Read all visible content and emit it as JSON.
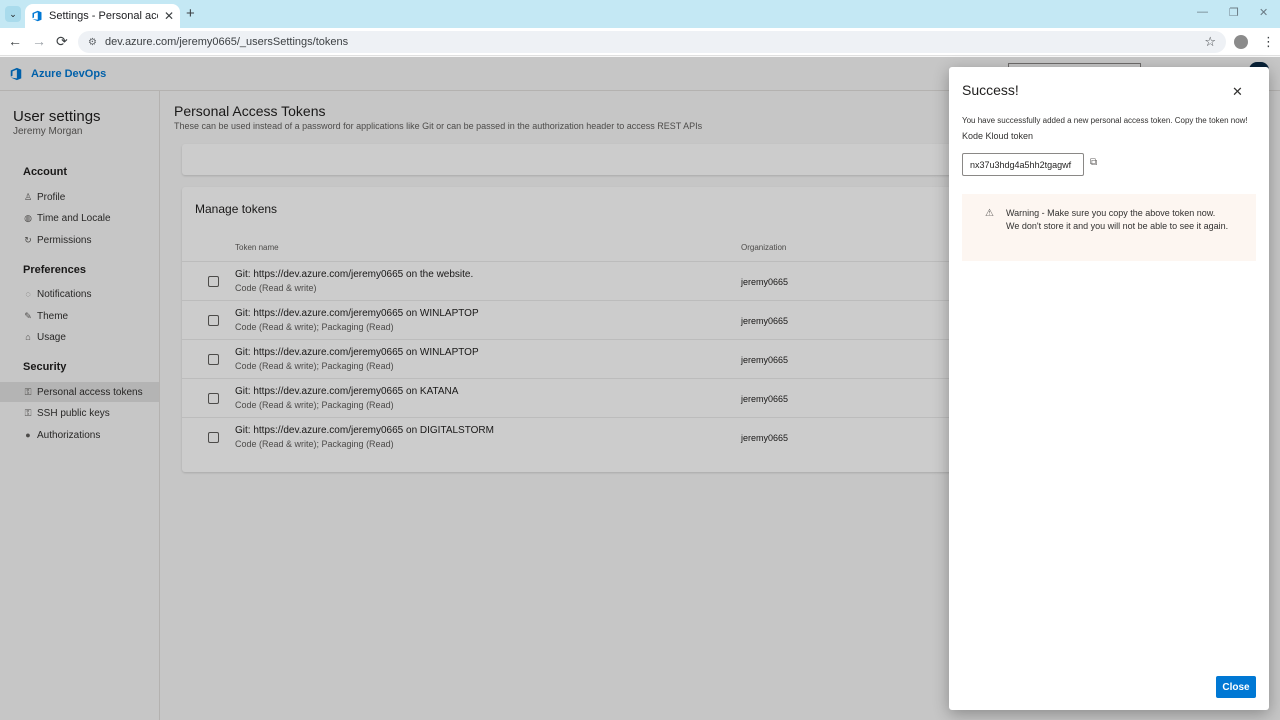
{
  "browser": {
    "tab_title": "Settings - Personal access tokens",
    "url": "dev.azure.com/jeremy0665/_usersSettings/tokens",
    "new_tab": "+",
    "back": "←",
    "forward": "→",
    "reload": "⟳",
    "bookmark": "☆",
    "menu": "⋮",
    "minimize": "—",
    "restore": "❐",
    "close_window": "✕"
  },
  "app": {
    "brand": "Azure DevOps"
  },
  "sidebar": {
    "title": "User settings",
    "user": "Jeremy Morgan",
    "groups": [
      {
        "title": "Account",
        "items": [
          {
            "label": "Profile",
            "icon": "person-icon",
            "glyph": "♙"
          },
          {
            "label": "Time and Locale",
            "icon": "globe-icon",
            "glyph": "◍"
          },
          {
            "label": "Permissions",
            "icon": "refresh-icon",
            "glyph": "↻"
          }
        ]
      },
      {
        "title": "Preferences",
        "items": [
          {
            "label": "Notifications",
            "icon": "chat-icon",
            "glyph": "◌"
          },
          {
            "label": "Theme",
            "icon": "theme-icon",
            "glyph": "✎"
          },
          {
            "label": "Usage",
            "icon": "usage-icon",
            "glyph": "⌂"
          }
        ]
      },
      {
        "title": "Security",
        "items": [
          {
            "label": "Personal access tokens",
            "icon": "key-icon",
            "glyph": "⚿",
            "selected": true
          },
          {
            "label": "SSH public keys",
            "icon": "ssh-key-icon",
            "glyph": "⚿"
          },
          {
            "label": "Authorizations",
            "icon": "lock-icon",
            "glyph": "●"
          }
        ]
      }
    ]
  },
  "main": {
    "title": "Personal Access Tokens",
    "subtitle": "These can be used instead of a password for applications like Git or can be passed in the authorization header to access REST APIs",
    "manage_title": "Manage tokens",
    "columns": [
      "Token name",
      "Organization"
    ],
    "tokens": [
      {
        "name": "Git: https://dev.azure.com/jeremy0665 on the website.",
        "scope": "Code (Read & write)",
        "org": "jeremy0665"
      },
      {
        "name": "Git: https://dev.azure.com/jeremy0665 on WINLAPTOP",
        "scope": "Code (Read & write); Packaging (Read)",
        "org": "jeremy0665"
      },
      {
        "name": "Git: https://dev.azure.com/jeremy0665 on WINLAPTOP",
        "scope": "Code (Read & write); Packaging (Read)",
        "org": "jeremy0665"
      },
      {
        "name": "Git: https://dev.azure.com/jeremy0665 on KATANA",
        "scope": "Code (Read & write); Packaging (Read)",
        "org": "jeremy0665"
      },
      {
        "name": "Git: https://dev.azure.com/jeremy0665 on DIGITALSTORM",
        "scope": "Code (Read & write); Packaging (Read)",
        "org": "jeremy0665"
      }
    ]
  },
  "panel": {
    "title": "Success!",
    "close_glyph": "✕",
    "message": "You have successfully added a new personal access token. Copy the token now!",
    "token_name": "Kode Kloud token",
    "token_value": "nx37u3hdg4a5hh2tgagwf",
    "copy_glyph": "⧉",
    "warning_glyph": "⚠",
    "warning": "Warning - Make sure you copy the above token now. We don't store it and you will not be able to see it again.",
    "close_button": "Close"
  },
  "colors": {
    "accent": "#0078d4",
    "warning_bg": "#fdf6f1",
    "tabbar": "#c4e8f4"
  }
}
